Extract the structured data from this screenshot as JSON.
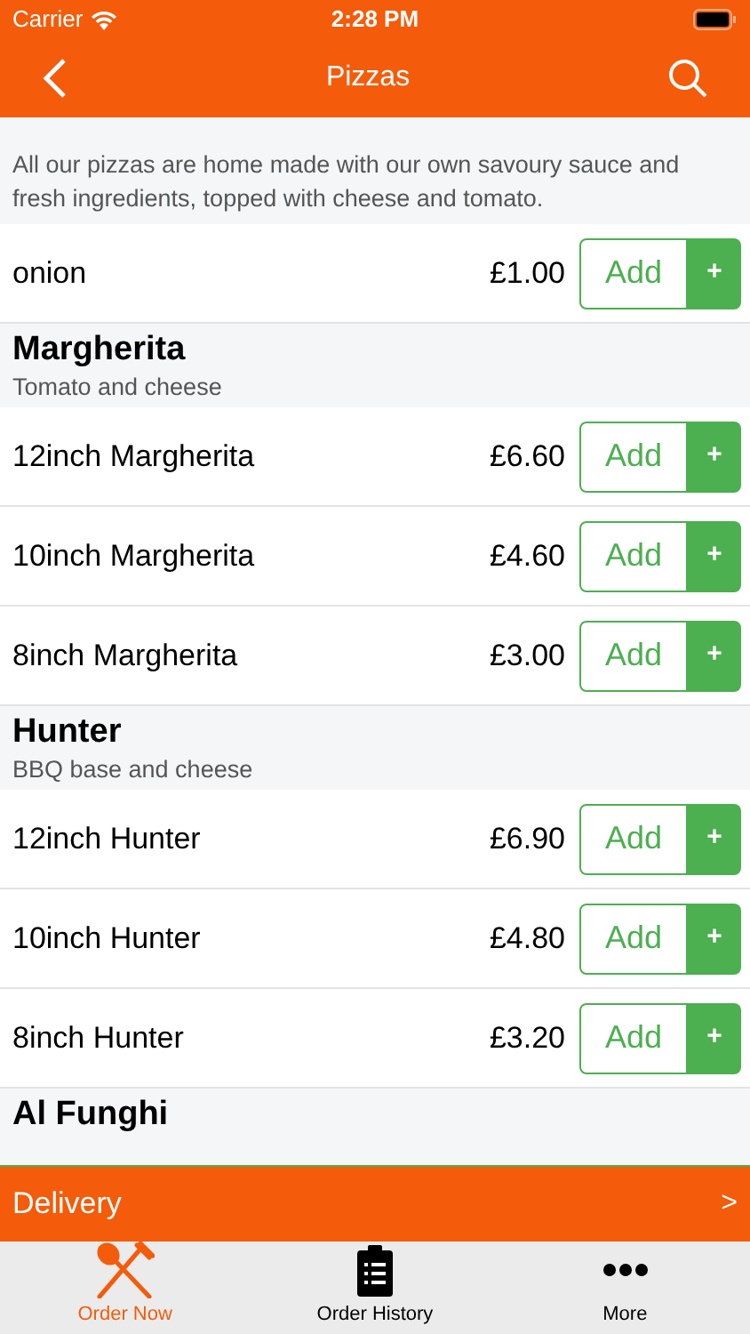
{
  "status_bar": {
    "carrier": "Carrier",
    "time": "2:28 PM"
  },
  "nav": {
    "title": "Pizzas"
  },
  "description": "All our pizzas are home made with our own savoury sauce and fresh ingredients, topped with cheese and tomato.",
  "menu": [
    {
      "kind": "item",
      "name": "onion",
      "price": "£1.00",
      "button": "Add",
      "plus": "+"
    },
    {
      "kind": "section",
      "name": "Margherita",
      "subtitle": "Tomato and cheese"
    },
    {
      "kind": "item",
      "name": "12inch Margherita",
      "price": "£6.60",
      "button": "Add",
      "plus": "+"
    },
    {
      "kind": "item",
      "name": "10inch Margherita",
      "price": "£4.60",
      "button": "Add",
      "plus": "+"
    },
    {
      "kind": "item",
      "name": "8inch Margherita",
      "price": "£3.00",
      "button": "Add",
      "plus": "+"
    },
    {
      "kind": "section",
      "name": "Hunter",
      "subtitle": "BBQ base and cheese"
    },
    {
      "kind": "item",
      "name": "12inch Hunter",
      "price": "£6.90",
      "button": "Add",
      "plus": "+"
    },
    {
      "kind": "item",
      "name": "10inch Hunter",
      "price": "£4.80",
      "button": "Add",
      "plus": "+"
    },
    {
      "kind": "item",
      "name": "8inch Hunter",
      "price": "£3.20",
      "button": "Add",
      "plus": "+"
    },
    {
      "kind": "section",
      "name": "Al Funghi"
    }
  ],
  "delivery_bar": {
    "label": "Delivery",
    "arrow": ">"
  },
  "tabs": [
    {
      "kind": "cutlery",
      "label": "Order Now",
      "selected": true
    },
    {
      "kind": "clipboard",
      "label": "Order History",
      "selected": false
    },
    {
      "kind": "more",
      "label": "More",
      "selected": false
    }
  ]
}
